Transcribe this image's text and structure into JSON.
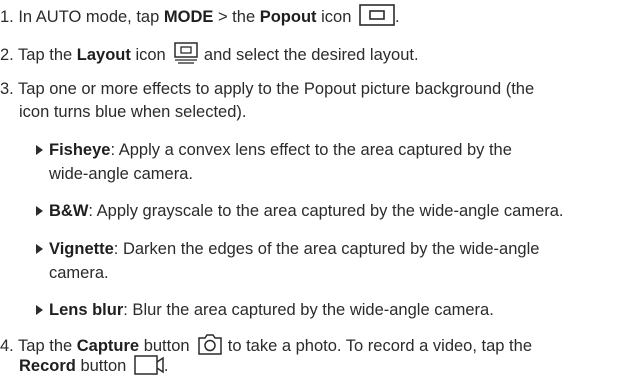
{
  "steps": {
    "s1": {
      "num": "1.",
      "pre": " In AUTO mode, tap ",
      "mode": "MODE",
      "mid": " > the ",
      "popout": "Popout",
      "post": " icon",
      "tail": "."
    },
    "s2": {
      "num": "2.",
      "pre": " Tap the ",
      "layout": "Layout",
      "mid": " icon",
      "post": " and select the desired layout."
    },
    "s3": {
      "num": "3.",
      "line1": " Tap one or more effects to apply to the Popout picture background (the",
      "line2": "icon turns blue when selected)."
    },
    "bullets": {
      "fisheye": {
        "term": "Fisheye",
        "line1": ": Apply a convex lens effect to the area captured by the",
        "line2": "wide-angle camera."
      },
      "bw": {
        "term": "B&W",
        "line1": ": Apply grayscale to the area captured by the wide-angle camera."
      },
      "vignette": {
        "term": "Vignette",
        "line1": ": Darken the edges of the area captured by the wide-angle",
        "line2": "camera."
      },
      "lensblur": {
        "term": "Lens blur",
        "line1": ": Blur the area captured by the wide-angle camera."
      }
    },
    "s4": {
      "num": "4.",
      "pre": " Tap the ",
      "capture": "Capture",
      "mid": " button",
      "post": " to take a photo. To record a video, tap the",
      "record": "Record",
      "mid2": " button",
      "tail": "."
    }
  },
  "icons": {
    "popout": "popout-icon",
    "layout": "layout-icon",
    "capture": "capture-icon",
    "record": "record-icon"
  }
}
